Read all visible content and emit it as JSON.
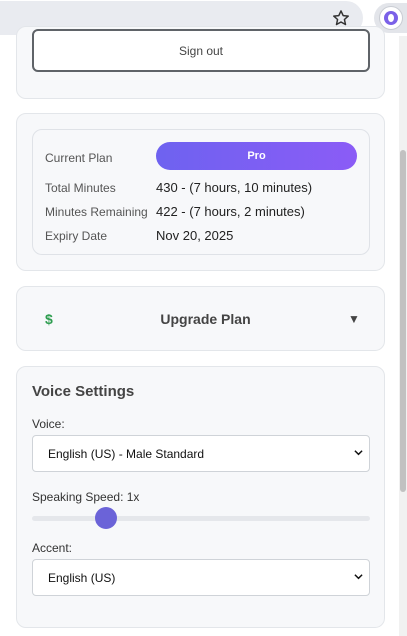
{
  "account": {
    "signout_label": "Sign out"
  },
  "plan": {
    "rows": [
      {
        "label": "Current Plan",
        "value": "Pro"
      },
      {
        "label": "Total Minutes",
        "value": "430 - (7 hours, 10 minutes)"
      },
      {
        "label": "Minutes Remaining",
        "value": "422 - (7 hours, 2 minutes)"
      },
      {
        "label": "Expiry Date",
        "value": "Nov 20, 2025"
      }
    ],
    "pill_gradient": [
      "#6e62f0",
      "#8b5cf6"
    ]
  },
  "upgrade": {
    "icon": "$",
    "title": "Upgrade Plan",
    "toggle": "▼",
    "icon_color": "#2e9d4f"
  },
  "voice_settings": {
    "title": "Voice Settings",
    "voice_label": "Voice:",
    "voice_value": "English (US) - Male Standard",
    "speed_label": "Speaking Speed: 1x",
    "speed_value": 1,
    "accent_label": "Accent:",
    "accent_value": "English (US)"
  },
  "browser": {
    "star_icon": "star-icon",
    "extension_icon": "extension-icon"
  }
}
